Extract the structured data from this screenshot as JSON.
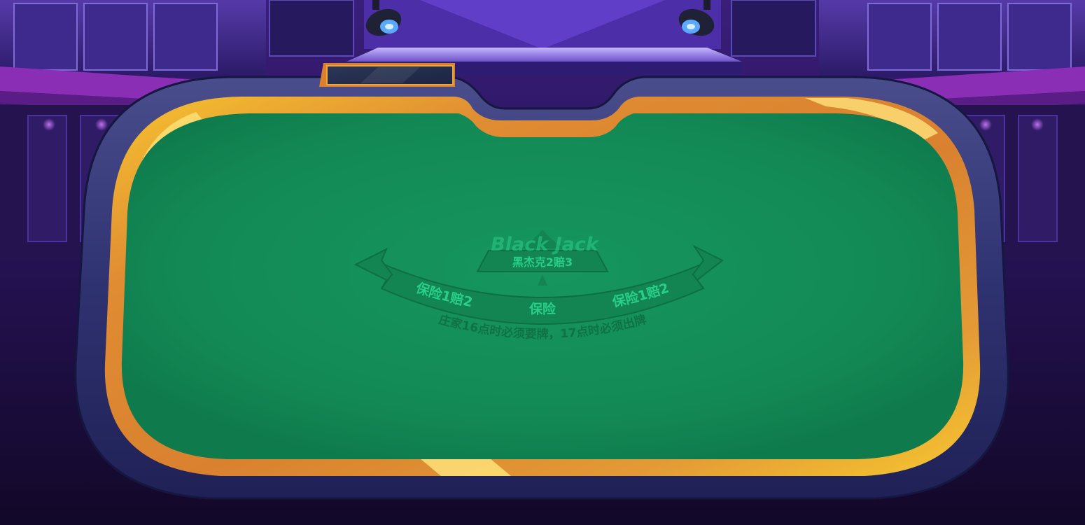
{
  "table": {
    "brand_title": "Black Jack",
    "blackjack_payout": "黑杰克2赔3",
    "insurance_left": "保险1赔2",
    "insurance_center": "保险",
    "insurance_right": "保险1赔2",
    "dealer_rule": "庄家16点时必须要牌，17点时必须出牌"
  },
  "colors": {
    "felt": "#15935e",
    "felt_dark": "#0f7a4c",
    "felt_text": "#2ad38b",
    "felt_band": "#128552",
    "rail_gold": "#f2b52a",
    "rail_orange": "#d9812f",
    "rail_frame": "#2b2d63",
    "background": "#1e0f45",
    "accent_purple": "#7a3bc4"
  },
  "icons": {
    "spotlight_left": "spotlight-icon",
    "spotlight_right": "spotlight-icon",
    "arrow_left": "arrow-left-icon",
    "arrow_right": "arrow-right-icon",
    "spade": "spade-icon"
  }
}
